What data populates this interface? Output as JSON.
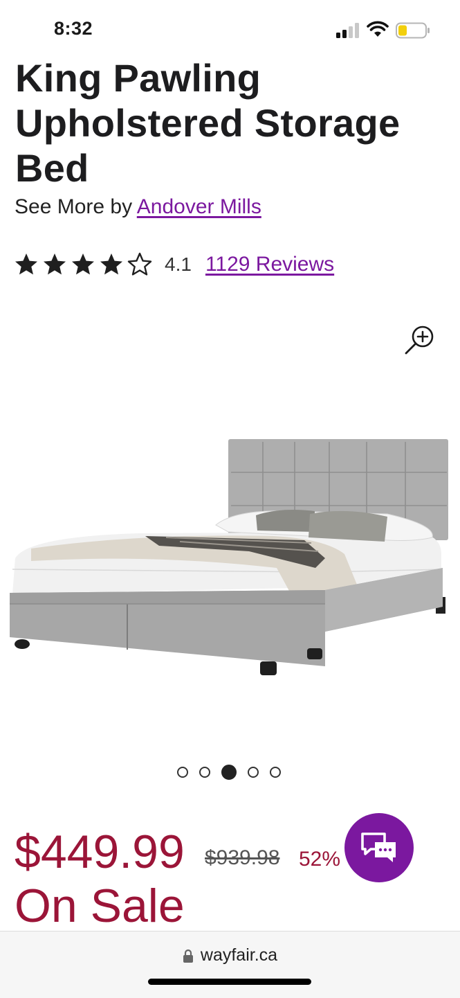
{
  "status_bar": {
    "time": "8:32"
  },
  "product": {
    "title": "King Pawling Upholstered Storage Bed",
    "see_more_prefix": "See More by",
    "brand": "Andover Mills",
    "rating": 4.1,
    "rating_text": "4.1",
    "reviews_link": "1129 Reviews",
    "stars": [
      "full",
      "full",
      "full",
      "full",
      "empty"
    ]
  },
  "gallery": {
    "image_count": 5,
    "active_index": 2,
    "image_alt": "upholstered grey storage bed"
  },
  "pricing": {
    "sale_price": "$449.99",
    "original_price": "$939.98",
    "discount": "52%",
    "sale_label": "On Sale"
  },
  "browser": {
    "url": "wayfair.ca"
  },
  "colors": {
    "brand_purple": "#7b189f",
    "sale_red": "#9b1538"
  },
  "icons": [
    "signal-icon",
    "wifi-icon",
    "battery-icon",
    "zoom-in-icon",
    "chat-icon",
    "lock-icon"
  ]
}
